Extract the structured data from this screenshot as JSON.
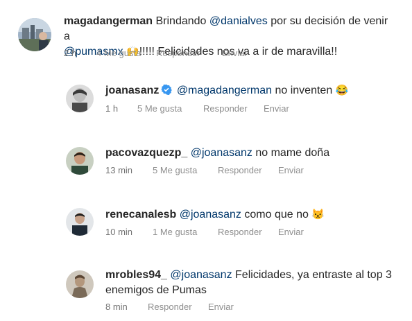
{
  "comments": [
    {
      "username": "magadangerman",
      "text_before": "Brindando",
      "mention": "@danialves",
      "text_mid": "por su decisión de venir a",
      "mention2": "@pumasmx",
      "emoji": "🙌",
      "text_after": "!!!!! Felicidades nos va a ir de maravilla!!",
      "time": "2 h",
      "likes": "4 Me gusta",
      "reply": "Responder",
      "send": "Enviar"
    },
    {
      "username": "joanasanz",
      "verified": true,
      "mention": "@magadangerman",
      "text": "no inventen",
      "emoji": "😂",
      "time": "1 h",
      "likes": "5 Me gusta",
      "reply": "Responder",
      "send": "Enviar"
    },
    {
      "username": "pacovazquezp_",
      "mention": "@joanasanz",
      "text": "no mame doña",
      "time": "13 min",
      "likes": "5 Me gusta",
      "reply": "Responder",
      "send": "Enviar"
    },
    {
      "username": "renecanalesb",
      "mention": "@joanasanz",
      "text": "como que no",
      "emoji": "😾",
      "time": "10 min",
      "likes": "1 Me gusta",
      "reply": "Responder",
      "send": "Enviar"
    },
    {
      "username": "mrobles94_",
      "mention": "@joanasanz",
      "text_line1": "Felicidades, ya entraste al top 3",
      "text_line2": "enemigos de Pumas",
      "time": "8 min",
      "reply": "Responder",
      "send": "Enviar"
    }
  ],
  "colors": {
    "text": "#262626",
    "mention": "#00376b",
    "meta": "#8e8e8e",
    "verified": "#3897f0"
  }
}
